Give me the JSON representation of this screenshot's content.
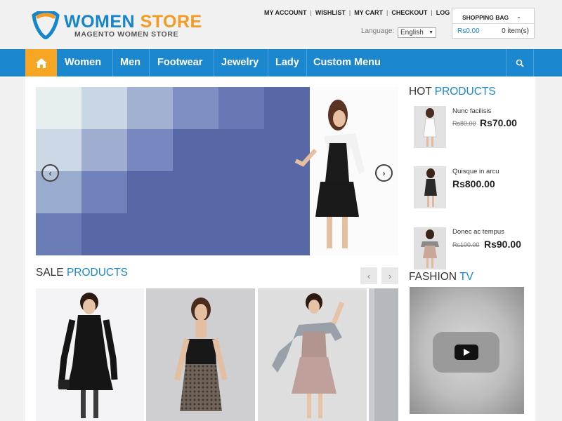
{
  "logo": {
    "title_prefix": "WOMEN",
    "title_suffix": "STORE",
    "subtitle": "MAGENTO WOMEN STORE"
  },
  "toplinks": [
    "MY ACCOUNT",
    "WISHLIST",
    "MY CART",
    "CHECKOUT",
    "LOG IN"
  ],
  "language": {
    "label": "Language:",
    "value": "English"
  },
  "cart": {
    "title": "SHOPPING BAG",
    "total": "Rs0.00",
    "items": "0 item(s)"
  },
  "nav": {
    "home_icon": "home-icon",
    "items": [
      "Women",
      "Men",
      "Footwear",
      "Jewelry",
      "Lady",
      "Custom Menu"
    ],
    "search_icon": "search-icon"
  },
  "hot_products": {
    "title_prefix": "HOT",
    "title_suffix": "PRODUCTS",
    "items": [
      {
        "name": "Nunc facilisis",
        "old_price": "Rs80.00",
        "price": "Rs70.00"
      },
      {
        "name": "Quisque in arcu",
        "old_price": "",
        "price": "Rs800.00"
      },
      {
        "name": "Donec ac tempus",
        "old_price": "Rs100.00",
        "price": "Rs90.00"
      }
    ]
  },
  "sale_products": {
    "title_prefix": "SALE",
    "title_suffix": "PRODUCTS"
  },
  "fashion_tv": {
    "title_prefix": "FASHION",
    "title_suffix": "TV"
  },
  "colors": {
    "brand_blue": "#1b87cf",
    "accent_orange": "#f6a623",
    "logo_orange": "#f39b22"
  }
}
